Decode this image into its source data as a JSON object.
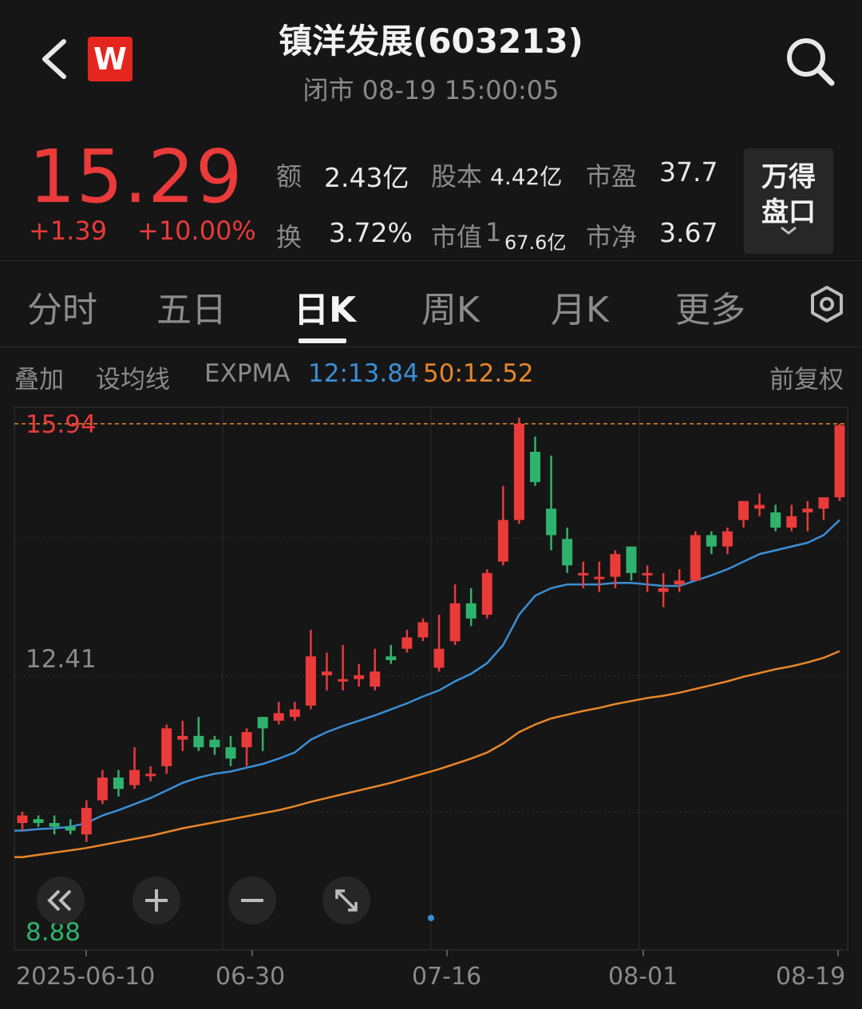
{
  "header": {
    "title": "镇洋发展(603213)",
    "status": "闭市 08-19 15:00:05",
    "logo_text": "W",
    "back_icon": "chevron-left-icon",
    "search_icon": "search-icon"
  },
  "quote": {
    "price": "15.29",
    "change": "+1.39",
    "change_pct": "+10.00%",
    "stats": [
      {
        "label": "额",
        "value": "2.43亿"
      },
      {
        "label": "股本",
        "value": "4.42亿"
      },
      {
        "label": "市盈",
        "value": "37.7"
      },
      {
        "label": "换",
        "value": "3.72%"
      },
      {
        "label": "市值",
        "value_prefix": "1",
        "value": "67.6亿"
      },
      {
        "label": "市净",
        "value": "3.67"
      }
    ],
    "wind_button": {
      "line1": "万得",
      "line2": "盘口"
    }
  },
  "tabs": [
    {
      "label": "分时",
      "active": false
    },
    {
      "label": "五日",
      "active": false
    },
    {
      "label": "日K",
      "active": true
    },
    {
      "label": "周K",
      "active": false
    },
    {
      "label": "月K",
      "active": false
    },
    {
      "label": "更多",
      "active": false
    }
  ],
  "settings_icon": "gear-hex-icon",
  "indicators": {
    "overlay": "叠加",
    "set_ma": "设均线",
    "name": "EXPMA",
    "ema12": "12:13.84",
    "ema50": "50:12.52",
    "adjust": "前复权"
  },
  "colors": {
    "up": "#ea3a3a",
    "down": "#2fb36c",
    "ema12": "#3a8fd6",
    "ema50": "#e8862a",
    "background": "#161616"
  },
  "controls": [
    "double-chevron-left-icon",
    "plus-icon",
    "minus-icon",
    "expand-icon"
  ],
  "chart_data": {
    "type": "candlestick",
    "y_labels": {
      "high": "15.94",
      "mid": "12.41",
      "low": "8.88"
    },
    "ylim": [
      8.88,
      15.94
    ],
    "dates": [
      "2025-06-10",
      "06-30",
      "07-16",
      "08-01",
      "08-19"
    ],
    "candles": [
      [
        10.45,
        10.55,
        10.35,
        10.6
      ],
      [
        10.5,
        10.45,
        10.4,
        10.55
      ],
      [
        10.45,
        10.4,
        10.3,
        10.55
      ],
      [
        10.4,
        10.35,
        10.3,
        10.5
      ],
      [
        10.3,
        10.65,
        10.2,
        10.75
      ],
      [
        10.75,
        11.05,
        10.7,
        11.15
      ],
      [
        11.05,
        10.9,
        10.8,
        11.15
      ],
      [
        10.95,
        11.15,
        10.9,
        11.45
      ],
      [
        11.1,
        11.1,
        11.0,
        11.2
      ],
      [
        11.2,
        11.7,
        11.1,
        11.75
      ],
      [
        11.55,
        11.6,
        11.4,
        11.8
      ],
      [
        11.6,
        11.45,
        11.4,
        11.85
      ],
      [
        11.55,
        11.45,
        11.35,
        11.6
      ],
      [
        11.45,
        11.3,
        11.2,
        11.6
      ],
      [
        11.45,
        11.65,
        11.2,
        11.7
      ],
      [
        11.85,
        11.7,
        11.4,
        11.85
      ],
      [
        11.8,
        11.9,
        11.75,
        12.05
      ],
      [
        11.85,
        11.95,
        11.8,
        12.05
      ],
      [
        12.0,
        12.65,
        11.95,
        13.0
      ],
      [
        12.4,
        12.45,
        12.2,
        12.7
      ],
      [
        12.35,
        12.35,
        12.2,
        12.8
      ],
      [
        12.35,
        12.4,
        12.25,
        12.55
      ],
      [
        12.25,
        12.45,
        12.2,
        12.75
      ],
      [
        12.65,
        12.6,
        12.55,
        12.8
      ],
      [
        12.75,
        12.9,
        12.7,
        13.0
      ],
      [
        12.9,
        13.1,
        12.85,
        13.15
      ],
      [
        12.5,
        12.75,
        12.45,
        13.2
      ],
      [
        12.85,
        13.35,
        12.8,
        13.6
      ],
      [
        13.35,
        13.15,
        13.05,
        13.55
      ],
      [
        13.2,
        13.75,
        13.15,
        13.8
      ],
      [
        13.9,
        14.45,
        13.85,
        14.9
      ],
      [
        14.45,
        15.72,
        14.4,
        15.8
      ],
      [
        15.35,
        14.95,
        14.9,
        15.55
      ],
      [
        14.6,
        14.25,
        14.05,
        15.3
      ],
      [
        14.2,
        13.85,
        13.75,
        14.35
      ],
      [
        13.75,
        13.75,
        13.55,
        13.9
      ],
      [
        13.7,
        13.7,
        13.5,
        13.9
      ],
      [
        13.7,
        14.0,
        13.55,
        14.05
      ],
      [
        14.1,
        13.75,
        13.65,
        14.1
      ],
      [
        13.75,
        13.75,
        13.5,
        13.85
      ],
      [
        13.5,
        13.55,
        13.3,
        13.75
      ],
      [
        13.6,
        13.65,
        13.5,
        13.8
      ],
      [
        13.65,
        14.25,
        13.65,
        14.3
      ],
      [
        14.25,
        14.1,
        14.0,
        14.3
      ],
      [
        14.1,
        14.3,
        14.0,
        14.35
      ],
      [
        14.45,
        14.7,
        14.35,
        14.7
      ],
      [
        14.6,
        14.65,
        14.5,
        14.8
      ],
      [
        14.55,
        14.35,
        14.3,
        14.65
      ],
      [
        14.35,
        14.5,
        14.3,
        14.65
      ],
      [
        14.55,
        14.6,
        14.3,
        14.7
      ],
      [
        14.6,
        14.75,
        14.45,
        14.75
      ],
      [
        14.75,
        15.7,
        14.7,
        15.72
      ]
    ],
    "ema12": [
      10.35,
      10.37,
      10.38,
      10.4,
      10.45,
      10.55,
      10.62,
      10.7,
      10.78,
      10.88,
      10.98,
      11.05,
      11.1,
      11.13,
      11.18,
      11.23,
      11.3,
      11.38,
      11.55,
      11.65,
      11.73,
      11.8,
      11.87,
      11.95,
      12.03,
      12.12,
      12.2,
      12.32,
      12.42,
      12.56,
      12.8,
      13.2,
      13.45,
      13.55,
      13.6,
      13.6,
      13.6,
      13.62,
      13.62,
      13.6,
      13.58,
      13.58,
      13.65,
      13.72,
      13.8,
      13.9,
      14.0,
      14.05,
      14.1,
      14.15,
      14.25,
      14.45
    ],
    "ema50": [
      10.0,
      10.03,
      10.06,
      10.09,
      10.12,
      10.16,
      10.2,
      10.24,
      10.28,
      10.33,
      10.38,
      10.42,
      10.46,
      10.5,
      10.54,
      10.58,
      10.62,
      10.67,
      10.73,
      10.78,
      10.83,
      10.88,
      10.93,
      10.98,
      11.04,
      11.1,
      11.16,
      11.23,
      11.3,
      11.38,
      11.5,
      11.65,
      11.75,
      11.83,
      11.88,
      11.93,
      11.97,
      12.02,
      12.06,
      12.1,
      12.13,
      12.17,
      12.22,
      12.27,
      12.32,
      12.38,
      12.43,
      12.48,
      12.52,
      12.57,
      12.63,
      12.72
    ],
    "ref_line": 15.72
  }
}
